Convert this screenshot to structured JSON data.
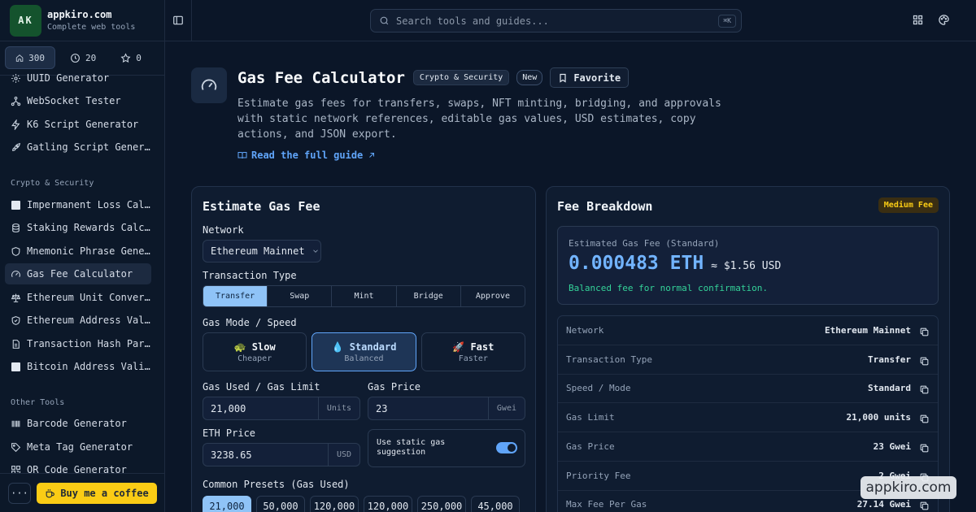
{
  "brand": {
    "initials": "AK",
    "name": "appkiro.com",
    "tagline": "Complete web tools"
  },
  "stats": [
    {
      "icon": "home-icon",
      "value": "300"
    },
    {
      "icon": "clock-icon",
      "value": "20"
    },
    {
      "icon": "star-icon",
      "value": "0"
    }
  ],
  "sidebar": {
    "items_top": [
      {
        "icon": "fingerprint-icon",
        "label": "UUID Generator"
      },
      {
        "icon": "network-icon",
        "label": "WebSocket Tester"
      },
      {
        "icon": "lightning-icon",
        "label": "K6 Script Generator"
      },
      {
        "icon": "rocket-icon",
        "label": "Gatling Script Generator"
      }
    ],
    "section_crypto": "Crypto & Security",
    "items_crypto": [
      {
        "icon": "square-icon",
        "label": "Impermanent Loss Calculator"
      },
      {
        "icon": "coins-icon",
        "label": "Staking Rewards Calculator"
      },
      {
        "icon": "shield-icon",
        "label": "Mnemonic Phrase Generator"
      },
      {
        "icon": "gauge-icon",
        "label": "Gas Fee Calculator"
      },
      {
        "icon": "scale-icon",
        "label": "Ethereum Unit Converter"
      },
      {
        "icon": "shield-check-icon",
        "label": "Ethereum Address Validator"
      },
      {
        "icon": "file-icon",
        "label": "Transaction Hash Parser"
      },
      {
        "icon": "square-icon",
        "label": "Bitcoin Address Validator"
      }
    ],
    "section_other": "Other Tools",
    "items_other": [
      {
        "icon": "barcode-icon",
        "label": "Barcode Generator"
      },
      {
        "icon": "tag-icon",
        "label": "Meta Tag Generator"
      },
      {
        "icon": "qr-icon",
        "label": "QR Code Generator"
      }
    ],
    "more_label": "···",
    "coffee_label": "Buy me a coffee"
  },
  "search": {
    "placeholder": "Search tools and guides...",
    "shortcut": "⌘K"
  },
  "tool": {
    "title": "Gas Fee Calculator",
    "category": "Crypto & Security",
    "badge": "New",
    "favorite_label": "Favorite",
    "description": "Estimate gas fees for transfers, swaps, NFT minting, bridging, and approvals with static network references, editable gas values, USD estimates, copy actions, and JSON export.",
    "guide_label": "Read the full guide"
  },
  "form": {
    "title": "Estimate Gas Fee",
    "network_label": "Network",
    "network_value": "Ethereum Mainnet",
    "tx_type_label": "Transaction Type",
    "tx_types": [
      "Transfer",
      "Swap",
      "Mint",
      "Bridge",
      "Approve"
    ],
    "tx_type_selected": "Transfer",
    "mode_label": "Gas Mode / Speed",
    "modes": [
      {
        "emoji": "🐢",
        "name": "Slow",
        "sub": "Cheaper"
      },
      {
        "emoji": "💧",
        "name": "Standard",
        "sub": "Balanced"
      },
      {
        "emoji": "🚀",
        "name": "Fast",
        "sub": "Faster"
      }
    ],
    "mode_selected": "Standard",
    "gas_used_label": "Gas Used / Gas Limit",
    "gas_used_value": "21,000",
    "gas_used_unit": "Units",
    "gas_price_label": "Gas Price",
    "gas_price_value": "23",
    "gas_price_unit": "Gwei",
    "eth_price_label": "ETH Price",
    "eth_price_value": "3238.65",
    "eth_price_unit": "USD",
    "static_toggle_label": "Use static gas suggestion",
    "static_toggle_on": true,
    "presets_label": "Common Presets (Gas Used)",
    "presets": [
      "21,000",
      "50,000",
      "120,000",
      "120,000",
      "250,000",
      "45,000"
    ],
    "preset_selected_index": 0
  },
  "breakdown": {
    "title": "Fee Breakdown",
    "level_badge": "Medium Fee",
    "estimated_label": "Estimated Gas Fee (Standard)",
    "estimated_eth": "0.000483 ETH",
    "estimated_usd": "≈ $1.56 USD",
    "estimated_note": "Balanced fee for normal confirmation.",
    "rows": [
      {
        "key": "Network",
        "value": "Ethereum Mainnet"
      },
      {
        "key": "Transaction Type",
        "value": "Transfer"
      },
      {
        "key": "Speed / Mode",
        "value": "Standard"
      },
      {
        "key": "Gas Limit",
        "value": "21,000 units"
      },
      {
        "key": "Gas Price",
        "value": "23 Gwei"
      },
      {
        "key": "Priority Fee",
        "value": "2 Gwei"
      },
      {
        "key": "Max Fee Per Gas",
        "value": "27.14 Gwei"
      }
    ]
  },
  "watermark": "appkiro.com",
  "colors": {
    "accent": "#60a5fa",
    "accent_light": "#8fc3f7",
    "success": "#34d399",
    "warning": "#facc15",
    "background": "#0b1628"
  }
}
